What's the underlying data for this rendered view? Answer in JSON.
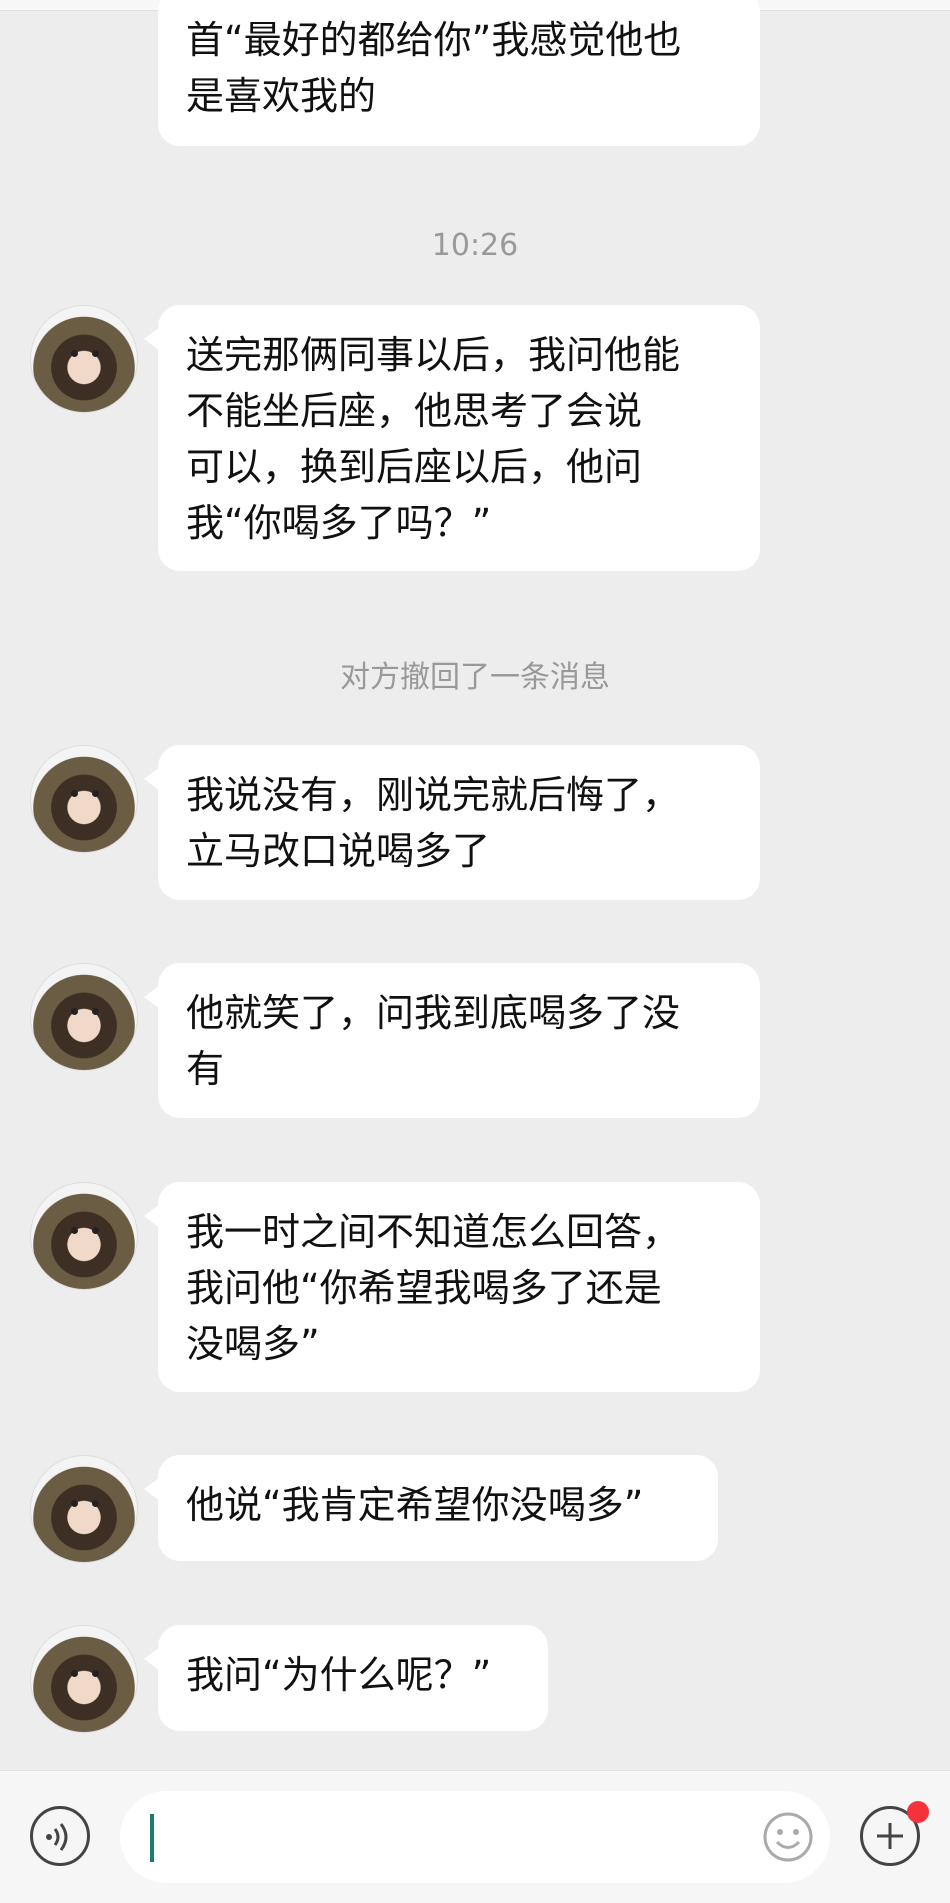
{
  "messages": [
    {
      "text": "首“最好的都给你”我感觉他也\n是喜欢我的",
      "avatar": false
    },
    {
      "text": "送完那俩同事以后，我问他能\n不能坐后座，他思考了会说\n可以，换到后座以后，他问\n我“你喝多了吗？”",
      "avatar": true
    },
    {
      "text": "我说没有，刚说完就后悔了，\n立马改口说喝多了",
      "avatar": true
    },
    {
      "text": "他就笑了，问我到底喝多了没\n有",
      "avatar": true
    },
    {
      "text": "我一时之间不知道怎么回答，\n我问他“你希望我喝多了还是\n没喝多”",
      "avatar": true
    },
    {
      "text": "他说“我肯定希望你没喝多”",
      "avatar": true
    },
    {
      "text": "我问“为什么呢？”",
      "avatar": true
    }
  ],
  "timestamp": "10:26",
  "recall_notice": "对方撤回了一条消息",
  "input": {
    "value": "",
    "placeholder": ""
  },
  "icons": {
    "voice": "voice-icon",
    "emoji": "emoji-icon",
    "plus": "plus-icon"
  },
  "colors": {
    "background": "#ededed",
    "bubble": "#ffffff",
    "badge": "#f4323a",
    "caret": "#1f7a6e"
  }
}
